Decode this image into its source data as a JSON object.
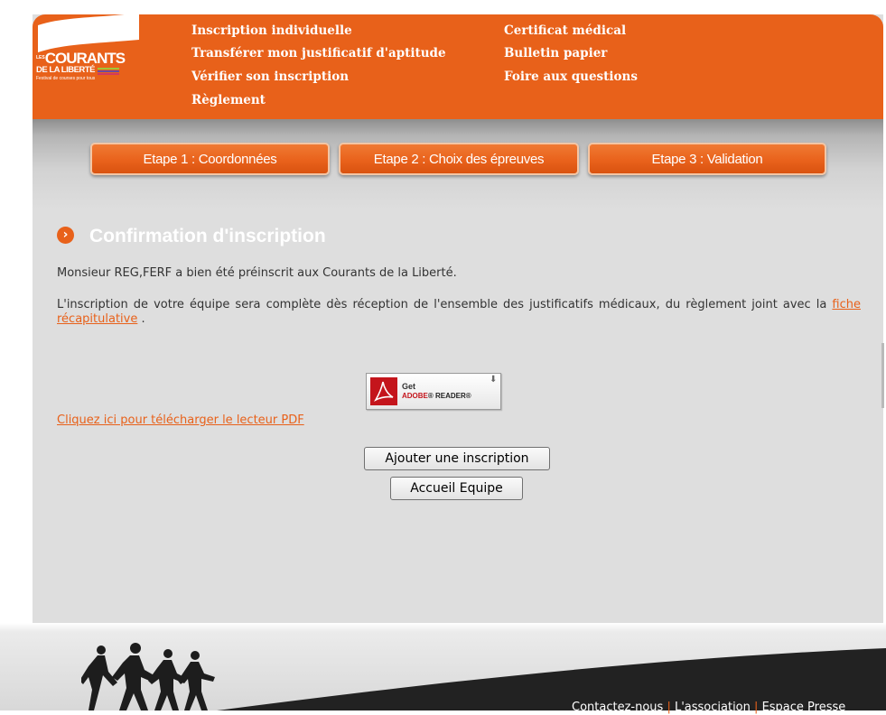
{
  "header": {
    "logo": {
      "prefix": "LES",
      "word1": "COURANTS",
      "word2": "DE LA LIBERTÉ",
      "tagline": "Festival de courses pour tous"
    },
    "nav": [
      {
        "label": "Inscription individuelle"
      },
      {
        "label": "Transférer mon justificatif d'aptitude"
      },
      {
        "label": "Vérifier son inscription"
      },
      {
        "label": "Règlement"
      },
      {
        "label": "Certificat médical"
      },
      {
        "label": "Bulletin papier"
      },
      {
        "label": "Foire aux questions"
      }
    ]
  },
  "steps": [
    {
      "label": "Etape 1 : Coordonnées"
    },
    {
      "label": "Etape 2 : Choix des épreuves"
    },
    {
      "label": "Etape 3 : Validation"
    }
  ],
  "main": {
    "title": "Confirmation d'inscription",
    "confirmation_text": "Monsieur REG,FERF a bien été préinscrit aux Courants de la Liberté.",
    "team_text_before": "L'inscription de votre équipe sera complète dès réception de l'ensemble des justificatifs médicaux, du règlement joint avec la",
    "team_link": "fiche récapitulative",
    "team_text_after": ".",
    "adobe_badge": {
      "get": "Get",
      "brand": "ADOBE",
      "product": "READER"
    },
    "pdf_link": "Cliquez ici pour télécharger le lecteur PDF",
    "add_button": "Ajouter une inscription",
    "home_button": "Accueil Equipe"
  },
  "footer": {
    "links": [
      {
        "label": "Contactez-nous"
      },
      {
        "label": "L'association"
      },
      {
        "label": "Espace Presse"
      }
    ]
  },
  "colors": {
    "brand_orange": "#e8611a",
    "panel_gray": "#dedede",
    "text": "#333333"
  }
}
